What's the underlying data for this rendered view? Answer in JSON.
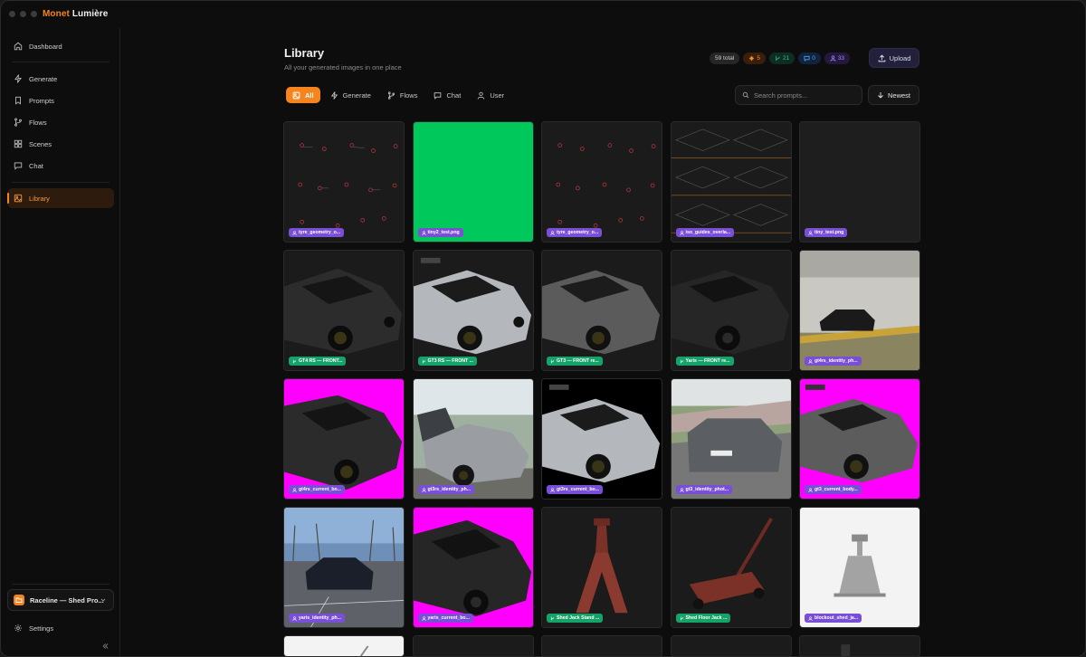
{
  "app": {
    "brand_first": "Monet",
    "brand_second": "Lumière"
  },
  "sidebar": {
    "items": [
      {
        "label": "Dashboard",
        "icon": "home-icon"
      },
      {
        "label": "Generate",
        "icon": "bolt-icon"
      },
      {
        "label": "Prompts",
        "icon": "bookmark-icon"
      },
      {
        "label": "Flows",
        "icon": "branch-icon"
      },
      {
        "label": "Scenes",
        "icon": "grid-icon"
      },
      {
        "label": "Chat",
        "icon": "chat-icon"
      },
      {
        "label": "Library",
        "icon": "image-icon",
        "active": true
      }
    ],
    "project": "Raceline — Shed Pro...",
    "settings": "Settings"
  },
  "header": {
    "title": "Library",
    "subtitle": "All your generated images in one place",
    "stats": {
      "total": "59 total",
      "generate": "5",
      "flows": "21",
      "chat": "0",
      "user": "33"
    },
    "upload": "Upload"
  },
  "filters": [
    "All",
    "Generate",
    "Flows",
    "Chat",
    "User"
  ],
  "search": {
    "placeholder": "Search prompts..."
  },
  "sort": "Newest",
  "colors": {
    "accent": "#f5841f",
    "user_tag": "#7a4fd8",
    "flow_tag": "#16a36a",
    "magenta": "#ff00ff",
    "green": "#00c85a"
  },
  "cards": [
    {
      "label": "tyre_geometry_o...",
      "source": "user"
    },
    {
      "label": "tiny2_test.png",
      "source": "user"
    },
    {
      "label": "tyre_geometry_o...",
      "source": "user"
    },
    {
      "label": "iso_guides_overla...",
      "source": "user"
    },
    {
      "label": "tiny_test.png",
      "source": "user"
    },
    {
      "label": "GT4 RS — FRONT...",
      "source": "flow"
    },
    {
      "label": "GT3 RS — FRONT ...",
      "source": "flow"
    },
    {
      "label": "GT3 — FRONT re...",
      "source": "flow"
    },
    {
      "label": "Yaris — FRONT re...",
      "source": "flow"
    },
    {
      "label": "gt4rs_identity_ph...",
      "source": "user"
    },
    {
      "label": "gt4rs_current_bo...",
      "source": "user"
    },
    {
      "label": "gt3rs_identity_ph...",
      "source": "user"
    },
    {
      "label": "gt3rs_current_bo...",
      "source": "user"
    },
    {
      "label": "gt3_identity_phot...",
      "source": "user"
    },
    {
      "label": "gt3_current_body...",
      "source": "user"
    },
    {
      "label": "yaris_identity_ph...",
      "source": "user"
    },
    {
      "label": "yaris_current_bo...",
      "source": "user"
    },
    {
      "label": "Shed Jack Stand ...",
      "source": "flow"
    },
    {
      "label": "Shed Floor Jack ...",
      "source": "flow"
    },
    {
      "label": "blockout_shed_ja...",
      "source": "user"
    }
  ]
}
